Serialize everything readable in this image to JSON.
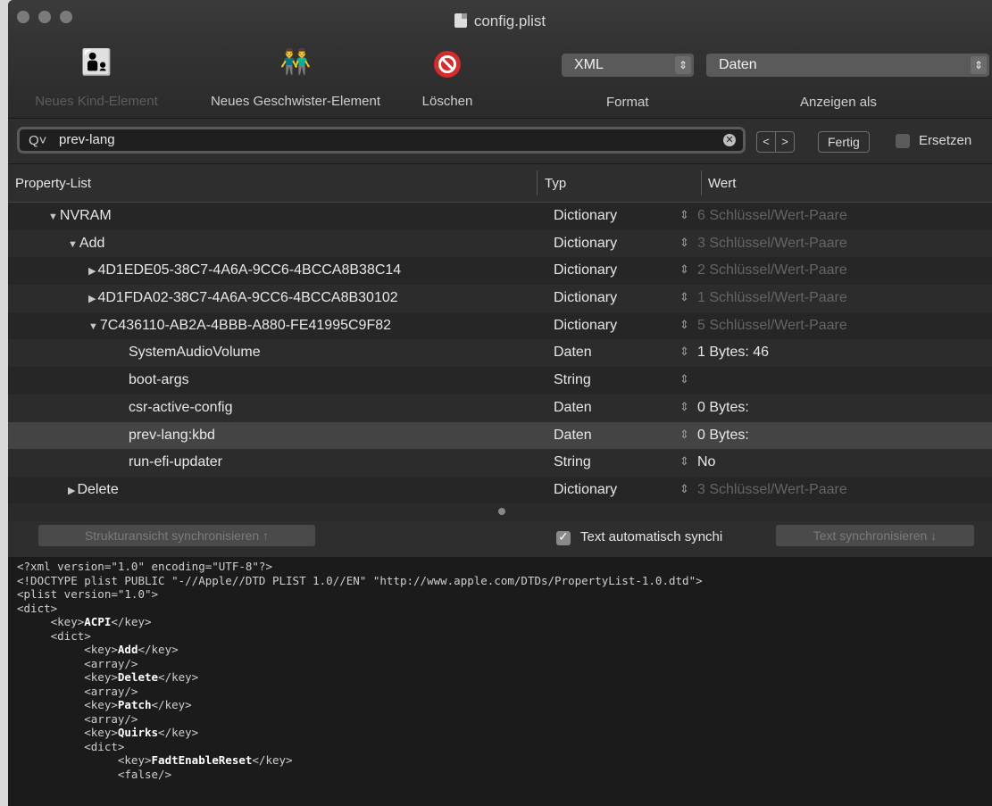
{
  "window": {
    "title": "config.plist"
  },
  "toolbar": {
    "new_child_label": "Neues Kind-Element",
    "new_sibling_label": "Neues Geschwister-Element",
    "delete_label": "Löschen",
    "format_value": "XML",
    "format_label": "Format",
    "display_value": "Daten",
    "display_label": "Anzeigen als"
  },
  "search": {
    "value": "prev-lang",
    "prev": "<",
    "next": ">",
    "done_label": "Fertig",
    "replace_label": "Ersetzen"
  },
  "table": {
    "columns": [
      "Property-List",
      "Typ",
      "Wert"
    ],
    "rows": [
      {
        "name": "NVRAM",
        "indent": 1,
        "disclosure": "open",
        "typ": "Dictionary",
        "wert": "6 Schlüssel/Wert-Paare",
        "dim": true
      },
      {
        "name": "Add",
        "indent": 2,
        "disclosure": "open",
        "typ": "Dictionary",
        "wert": "3 Schlüssel/Wert-Paare",
        "dim": true
      },
      {
        "name": "4D1EDE05-38C7-4A6A-9CC6-4BCCA8B38C14",
        "indent": 3,
        "disclosure": "closed",
        "typ": "Dictionary",
        "wert": "2 Schlüssel/Wert-Paare",
        "dim": true
      },
      {
        "name": "4D1FDA02-38C7-4A6A-9CC6-4BCCA8B30102",
        "indent": 3,
        "disclosure": "closed",
        "typ": "Dictionary",
        "wert": "1 Schlüssel/Wert-Paare",
        "dim": true
      },
      {
        "name": "7C436110-AB2A-4BBB-A880-FE41995C9F82",
        "indent": 3,
        "disclosure": "open",
        "typ": "Dictionary",
        "wert": "5 Schlüssel/Wert-Paare",
        "dim": true
      },
      {
        "name": "SystemAudioVolume",
        "indent": 4,
        "disclosure": "none",
        "typ": "Daten",
        "wert": "1 Bytes: 46",
        "dim": false
      },
      {
        "name": "boot-args",
        "indent": 4,
        "disclosure": "none",
        "typ": "String",
        "wert": "",
        "dim": false
      },
      {
        "name": "csr-active-config",
        "indent": 4,
        "disclosure": "none",
        "typ": "Daten",
        "wert": "0 Bytes:",
        "dim": false
      },
      {
        "name": "prev-lang:kbd",
        "indent": 4,
        "disclosure": "none",
        "typ": "Daten",
        "wert": "0 Bytes:",
        "dim": false,
        "selected": true
      },
      {
        "name": "run-efi-updater",
        "indent": 4,
        "disclosure": "none",
        "typ": "String",
        "wert": "No",
        "dim": false
      },
      {
        "name": "Delete",
        "indent": 2,
        "disclosure": "closed",
        "typ": "Dictionary",
        "wert": "3 Schlüssel/Wert-Paare",
        "dim": true
      }
    ]
  },
  "sync": {
    "structure_sync_label": "Strukturansicht synchronisieren ↑",
    "auto_sync_label": "Text automatisch synchi",
    "auto_sync_checked": true,
    "text_sync_label": "Text synchronisieren ↓"
  },
  "code": {
    "lines": [
      "<?xml version=\"1.0\" encoding=\"UTF-8\"?>",
      "<!DOCTYPE plist PUBLIC \"-//Apple//DTD PLIST 1.0//EN\" \"http://www.apple.com/DTDs/PropertyList-1.0.dtd\">",
      "<plist version=\"1.0\">",
      "<dict>",
      "     <key>ACPI</key>",
      "     <dict>",
      "          <key>Add</key>",
      "          <array/>",
      "          <key>Delete</key>",
      "          <array/>",
      "          <key>Patch</key>",
      "          <array/>",
      "          <key>Quirks</key>",
      "          <dict>",
      "               <key>FadtEnableReset</key>",
      "               <false/>"
    ]
  }
}
